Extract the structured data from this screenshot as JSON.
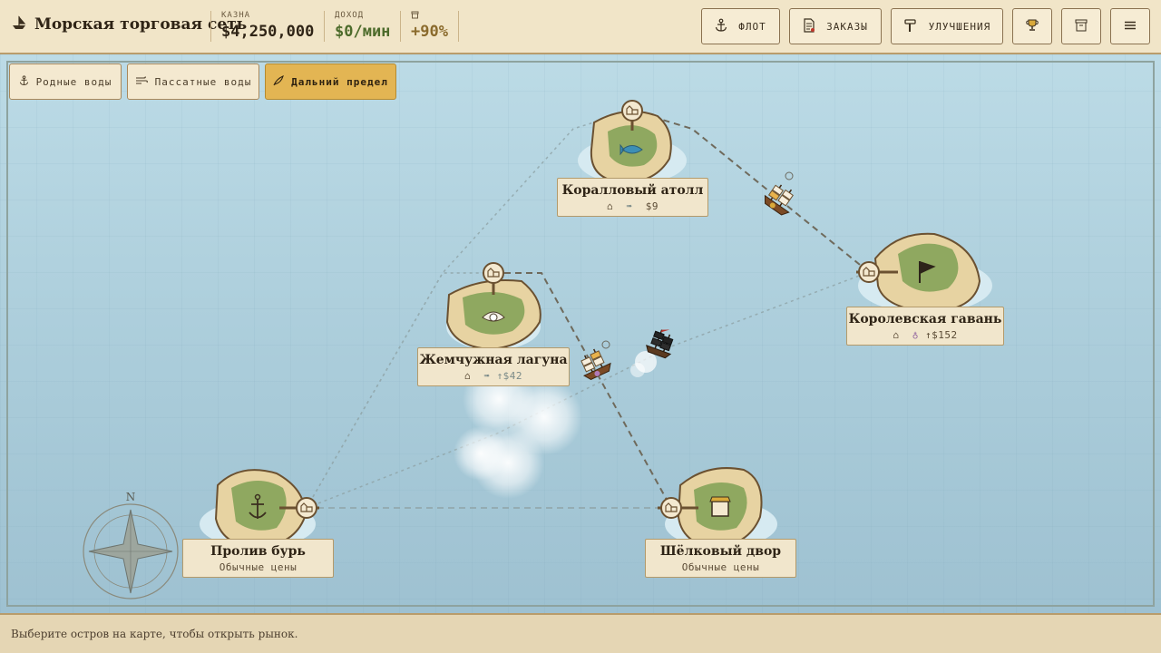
{
  "header": {
    "title": "Морская торговая сеть",
    "treasury_label": "КАЗНА",
    "treasury_value": "$4,250,000",
    "income_label": "ДОХОД",
    "income_value": "$0/мин",
    "bonus_value": "+90%"
  },
  "toolbar": {
    "fleet_label": "ФЛОТ",
    "orders_label": "ЗАКАЗЫ",
    "upgrades_label": "УЛУЧШЕНИЯ"
  },
  "regions": [
    {
      "label": "Родные воды",
      "active": false
    },
    {
      "label": "Пассатные воды",
      "active": false
    },
    {
      "label": "Дальний предел",
      "active": true
    }
  ],
  "islands": {
    "coral": {
      "name": "Коралловый атолл",
      "price": "$9"
    },
    "royal": {
      "name": "Королевская гавань",
      "price": "↑$152"
    },
    "pearl": {
      "name": "Жемчужная лагуна",
      "price": "↑$42"
    },
    "storm": {
      "name": "Пролив бурь",
      "note": "Обычные цены"
    },
    "silk": {
      "name": "Шёлковый двор",
      "note": "Обычные цены"
    }
  },
  "compass": {
    "north": "N"
  },
  "status": {
    "hint": "Выберите остров на карте, чтобы открыть рынок."
  },
  "colors": {
    "accent": "#e3b553",
    "parchment": "#f1e6cc",
    "sea": "#b3d3df",
    "income_green": "#4d6b2b"
  }
}
